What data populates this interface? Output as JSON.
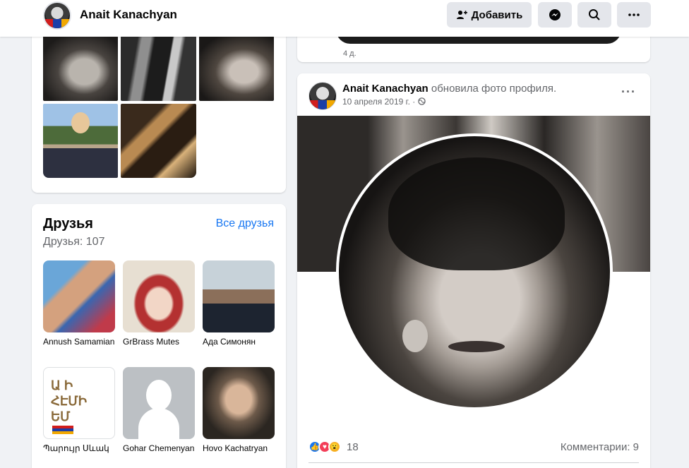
{
  "header": {
    "name": "Anait Kanachyan",
    "add_label": "Добавить"
  },
  "friends": {
    "title": "Друзья",
    "count": "Друзья: 107",
    "all_link": "Все друзья",
    "items": [
      {
        "name": "Annush Samamian"
      },
      {
        "name": "GrBrass Mutes"
      },
      {
        "name": "Ада Симонян"
      },
      {
        "name": "Պարույր Սևակ"
      },
      {
        "name": "Gohar Chemenyan"
      },
      {
        "name": "Hovo Kachatryan"
      }
    ]
  },
  "prev_post": {
    "time": "4 д."
  },
  "post": {
    "author": "Anait Kanachyan",
    "action": "обновила фото профиля.",
    "date": "10 апреля 2019 г. ·",
    "reaction_count": "18",
    "comments": "Комментарии: 9"
  }
}
